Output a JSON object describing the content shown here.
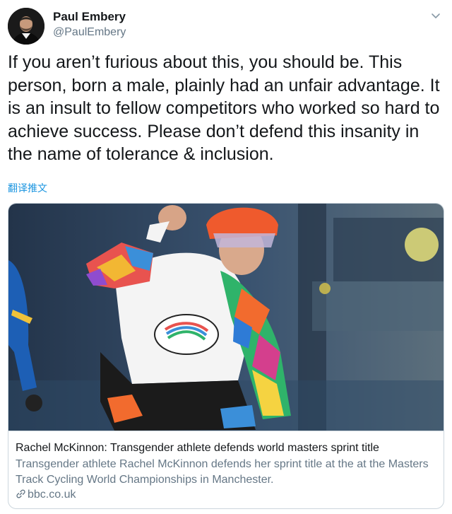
{
  "tweet": {
    "author": {
      "name": "Paul Embery",
      "handle": "@PaulEmbery"
    },
    "text": "If you aren’t furious about this, you should be. This person, born a male, plainly had an unfair advantage. It is an insult to fellow competitors who worked so hard to achieve success. Please don’t defend this insanity in the name of tolerance & inclusion.",
    "translate_label": "翻译推文",
    "card": {
      "title": "Rachel McKinnon: Transgender athlete defends world masters sprint title",
      "description": "Transgender athlete Rachel McKinnon defends her sprint title at the at the Masters Track Cycling World Championships in Manchester.",
      "domain": "bbc.co.uk",
      "image_icon": "cyclist-photo"
    },
    "icons": {
      "menu": "chevron-down-icon",
      "link": "link-icon"
    },
    "colors": {
      "text": "#14171a",
      "secondary": "#657786",
      "link": "#1b95e0",
      "border": "#ccd6dd"
    }
  }
}
